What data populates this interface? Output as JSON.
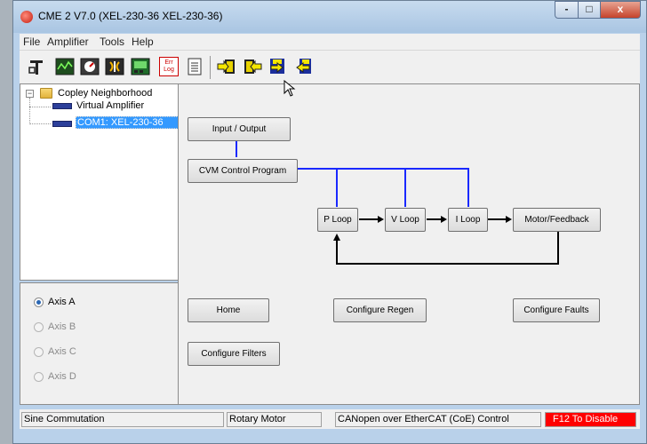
{
  "window": {
    "title": "CME 2 V7.0 (XEL-230-36 XEL-230-36)"
  },
  "titlebar_buttons": {
    "minimize": "-",
    "maximize": "□",
    "close": "x"
  },
  "menu": [
    "File",
    "Amplifier",
    "Tools",
    "Help"
  ],
  "toolbar": {
    "errlog_text": "Err Log",
    "icons": [
      "home-config-icon",
      "scope-icon",
      "control-panel-icon",
      "auto-phase-icon",
      "io-monitor-icon",
      "error-log-icon",
      "notes-icon",
      "save-to-amp-icon",
      "restore-from-amp-icon",
      "save-to-disk-icon",
      "restore-from-disk-icon"
    ]
  },
  "tree": {
    "root": "Copley Neighborhood",
    "children": [
      "Virtual Amplifier",
      "COM1: XEL-230-36"
    ],
    "selected_index": 1
  },
  "axes": [
    {
      "label": "Axis A",
      "selected": true,
      "enabled": true
    },
    {
      "label": "Axis B",
      "selected": false,
      "enabled": false
    },
    {
      "label": "Axis C",
      "selected": false,
      "enabled": false
    },
    {
      "label": "Axis D",
      "selected": false,
      "enabled": false
    }
  ],
  "diagram": {
    "input_output": "Input / Output",
    "cvm": "CVM Control Program",
    "p_loop": "P Loop",
    "v_loop": "V Loop",
    "i_loop": "I Loop",
    "motor_feedback": "Motor/Feedback",
    "link_color": "#1a29ff"
  },
  "buttons": {
    "home": "Home",
    "configure_regen": "Configure Regen",
    "configure_faults": "Configure Faults",
    "configure_filters": "Configure Filters"
  },
  "status": {
    "commutation": "Sine Commutation",
    "motor": "Rotary Motor",
    "network": "CANopen over EtherCAT (CoE) Control",
    "disable": "F12 To Disable",
    "disable_color": "#ff0000"
  }
}
